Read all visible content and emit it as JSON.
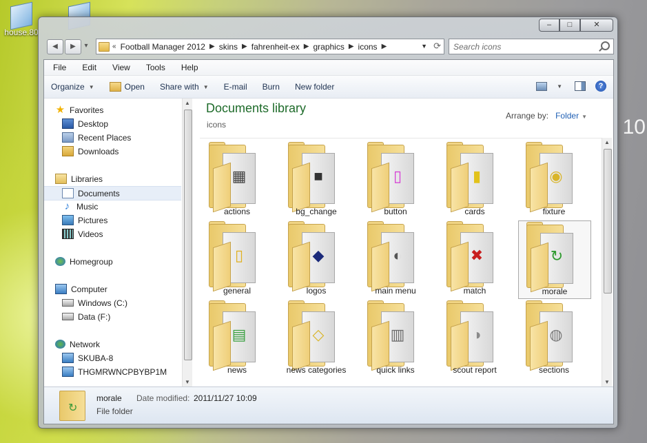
{
  "desktop": {
    "icons": [
      {
        "label": "house.80"
      },
      {
        "label": ""
      }
    ],
    "clock_fragment": "10"
  },
  "window": {
    "caption_buttons": {
      "minimize": "‒",
      "maximize": "□",
      "close": "✕"
    },
    "nav": {
      "back": "◀",
      "forward": "▶",
      "recent": "▾"
    },
    "address": {
      "prefix": "«",
      "crumbs": [
        "Football Manager 2012",
        "skins",
        "fahrenheit-ex",
        "graphics",
        "icons"
      ]
    },
    "search": {
      "placeholder": "Search icons"
    },
    "menu": [
      "File",
      "Edit",
      "View",
      "Tools",
      "Help"
    ],
    "toolbar": {
      "organize": "Organize",
      "open": "Open",
      "share_with": "Share with",
      "email": "E-mail",
      "burn": "Burn",
      "new_folder": "New folder",
      "help": "?"
    },
    "navpane": {
      "favorites": {
        "label": "Favorites",
        "items": [
          "Desktop",
          "Recent Places",
          "Downloads"
        ]
      },
      "libraries": {
        "label": "Libraries",
        "items": [
          "Documents",
          "Music",
          "Pictures",
          "Videos"
        ]
      },
      "homegroup": "Homegroup",
      "computer": {
        "label": "Computer",
        "items": [
          "Windows (C:)",
          "Data (F:)"
        ]
      },
      "network": {
        "label": "Network",
        "items": [
          "SKUBA-8",
          "THGMRWNCPBYBP1M"
        ]
      }
    },
    "content": {
      "title": "Documents library",
      "subtitle": "icons",
      "arrange_label": "Arrange by:",
      "arrange_value": "Folder",
      "folders": [
        {
          "name": "actions",
          "glyph": "▦",
          "color": "#444444"
        },
        {
          "name": "bg_change",
          "glyph": "■",
          "color": "#333333"
        },
        {
          "name": "button",
          "glyph": "▯",
          "color": "#d63ad6"
        },
        {
          "name": "cards",
          "glyph": "▮",
          "color": "#e2c21b"
        },
        {
          "name": "fixture",
          "glyph": "◉",
          "color": "#d9b52a"
        },
        {
          "name": "general",
          "glyph": "▯",
          "color": "#e0b020"
        },
        {
          "name": "logos",
          "glyph": "◆",
          "color": "#1b2a7a"
        },
        {
          "name": "main menu",
          "glyph": "◐",
          "color": "#555555"
        },
        {
          "name": "match",
          "glyph": "✖",
          "color": "#c81e1e"
        },
        {
          "name": "morale",
          "glyph": "↻",
          "color": "#2e9a2e"
        },
        {
          "name": "news",
          "glyph": "▤",
          "color": "#3aa040"
        },
        {
          "name": "news categories",
          "glyph": "◇",
          "color": "#d9b52a"
        },
        {
          "name": "quick links",
          "glyph": "▥",
          "color": "#6a6a6a"
        },
        {
          "name": "scout report",
          "glyph": "◑",
          "color": "#8a8a8a"
        },
        {
          "name": "sections",
          "glyph": "◍",
          "color": "#7a7a7a"
        }
      ],
      "selected": "morale"
    },
    "details": {
      "name": "morale",
      "modified_label": "Date modified:",
      "modified_value": "2011/11/27 10:09",
      "type": "File folder"
    }
  }
}
